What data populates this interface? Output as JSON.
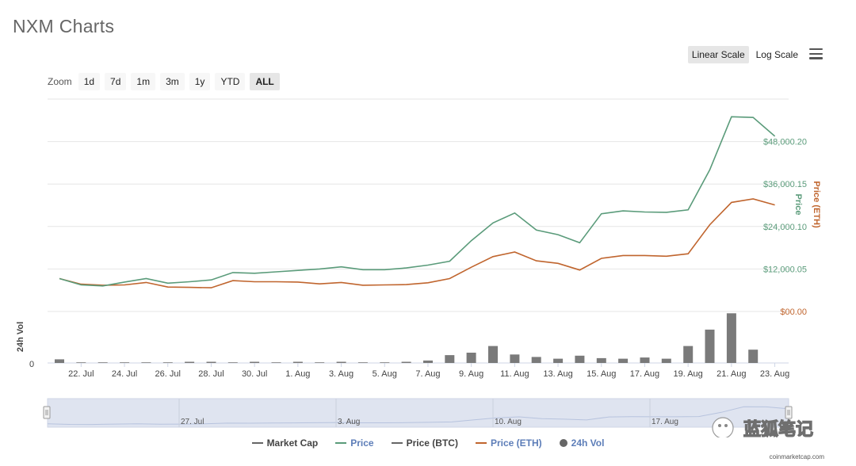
{
  "title": "NXM Charts",
  "scale": {
    "linear_label": "Linear Scale",
    "log_label": "Log Scale"
  },
  "zoom": {
    "label": "Zoom",
    "options": [
      "1d",
      "7d",
      "1m",
      "3m",
      "1y",
      "YTD",
      "ALL"
    ],
    "active": "ALL"
  },
  "axes": {
    "price_label": "Price",
    "price_eth_label": "Price (ETH)",
    "vol_label": "24h Vol",
    "vol_zero": "0"
  },
  "navigator": {
    "labels": [
      "27. Jul",
      "3. Aug",
      "10. Aug",
      "17. Aug"
    ]
  },
  "legend": [
    {
      "label": "Market Cap",
      "color": "#666666",
      "shape": "line",
      "highlight": false
    },
    {
      "label": "Price",
      "color": "#5a9b7a",
      "shape": "line",
      "highlight": true
    },
    {
      "label": "Price (BTC)",
      "color": "#666666",
      "shape": "line",
      "highlight": false
    },
    {
      "label": "Price (ETH)",
      "color": "#c0652e",
      "shape": "line",
      "highlight": true
    },
    {
      "label": "24h Vol",
      "color": "#666666",
      "shape": "dot",
      "highlight": true
    }
  ],
  "credit": "coinmarketcap.com",
  "watermark": "蓝狐笔记",
  "colors": {
    "price": "#5a9b7a",
    "eth": "#c0652e",
    "vol": "#7a7a7a",
    "highlight": "#5c7db8"
  },
  "chart_data": {
    "type": "line",
    "x_ticks": [
      "22. Jul",
      "24. Jul",
      "26. Jul",
      "28. Jul",
      "30. Jul",
      "1. Aug",
      "3. Aug",
      "5. Aug",
      "7. Aug",
      "9. Aug",
      "11. Aug",
      "13. Aug",
      "15. Aug",
      "17. Aug",
      "19. Aug",
      "21. Aug",
      "23. Aug"
    ],
    "y_ticks": [
      "$00.00",
      "$12,000.05",
      "$24,000.10",
      "$36,000.15",
      "$48,000.20"
    ],
    "y_tick_values": [
      0,
      12000.05,
      24000.1,
      36000.15,
      48000.2
    ],
    "ylim": [
      0,
      60000
    ],
    "x_days": [
      0,
      1,
      2,
      3,
      4,
      5,
      6,
      7,
      8,
      9,
      10,
      11,
      12,
      13,
      14,
      15,
      16,
      17,
      18,
      19,
      20,
      21,
      22,
      23,
      24,
      25,
      26,
      27,
      28,
      29,
      30,
      31,
      32,
      33
    ],
    "series": [
      {
        "name": "Price",
        "axis": "left",
        "values": [
          9300,
          7500,
          7200,
          8300,
          9300,
          8000,
          8400,
          8900,
          11000,
          10800,
          11200,
          11600,
          12000,
          12600,
          11800,
          11800,
          12300,
          13100,
          14200,
          20000,
          25000,
          27800,
          23000,
          21700,
          19400,
          27600,
          28400,
          28100,
          28000,
          28700,
          40000,
          55000,
          54800,
          49500
        ]
      },
      {
        "name": "Price (ETH)",
        "axis": "right",
        "values": [
          9300,
          7700,
          7400,
          7500,
          8200,
          6900,
          6800,
          6700,
          8700,
          8400,
          8400,
          8300,
          7800,
          8200,
          7400,
          7500,
          7600,
          8100,
          9300,
          12500,
          15500,
          16800,
          14300,
          13600,
          11700,
          15000,
          15800,
          15800,
          15600,
          16300,
          24500,
          30800,
          31800,
          30100
        ]
      },
      {
        "name": "24h Vol",
        "axis": "vol",
        "values": [
          6,
          1,
          1,
          1,
          1,
          1,
          2,
          2,
          1,
          2,
          1,
          2,
          1,
          2,
          1,
          1,
          2,
          4,
          13,
          17,
          28,
          14,
          10,
          7,
          12,
          8,
          7,
          9,
          7,
          28,
          55,
          82,
          22
        ]
      }
    ]
  }
}
